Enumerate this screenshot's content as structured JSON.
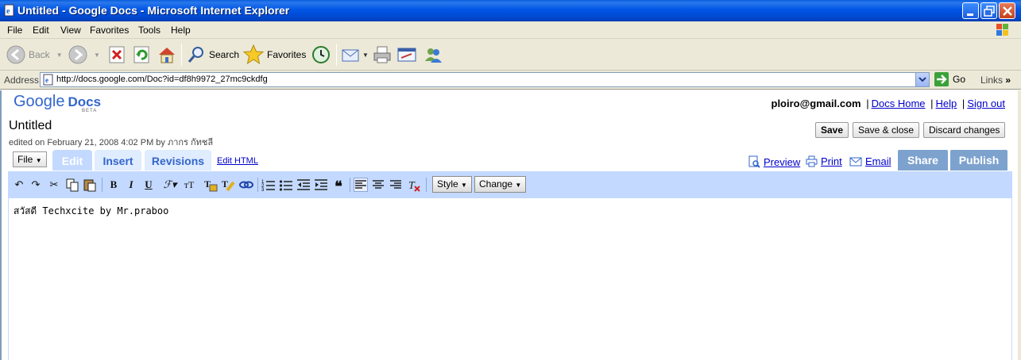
{
  "window": {
    "title": "Untitled - Google Docs - Microsoft Internet Explorer"
  },
  "menu": {
    "items": [
      "File",
      "Edit",
      "View",
      "Favorites",
      "Tools",
      "Help"
    ]
  },
  "toolbar": {
    "back_label": "Back",
    "search_label": "Search",
    "favorites_label": "Favorites"
  },
  "address": {
    "label": "Address",
    "url": "http://docs.google.com/Doc?id=df8h9972_27mc9ckdfg",
    "go_label": "Go",
    "links_label": "Links"
  },
  "app": {
    "logo_google": "Google",
    "logo_docs": "Docs",
    "logo_beta": "BETA",
    "user_email": "ploiro@gmail.com",
    "link_docs_home": "Docs Home",
    "link_help": "Help",
    "link_sign_out": "Sign out",
    "link_sep": "|"
  },
  "document": {
    "title": "Untitled",
    "edited_info": "edited on February 21, 2008 4:02 PM by ภากร กัทชลี",
    "content": "สวัสดี Techxcite by Mr.praboo"
  },
  "doc_actions": {
    "save": "Save",
    "save_close": "Save & close",
    "discard": "Discard changes"
  },
  "tabs": {
    "file_menu": "File",
    "edit": "Edit",
    "insert": "Insert",
    "revisions": "Revisions",
    "edit_html": "Edit HTML",
    "preview": "Preview",
    "print": "Print",
    "email": "Email",
    "share": "Share",
    "publish": "Publish"
  },
  "editor_toolbar": {
    "style_label": "Style",
    "change_label": "Change"
  },
  "colors": {
    "tab_active": "#c3d9ff",
    "tab_inactive": "#e0ecff",
    "share_publish": "#7da2ce",
    "link": "#0000cc",
    "titlebar": "#0055e5"
  }
}
